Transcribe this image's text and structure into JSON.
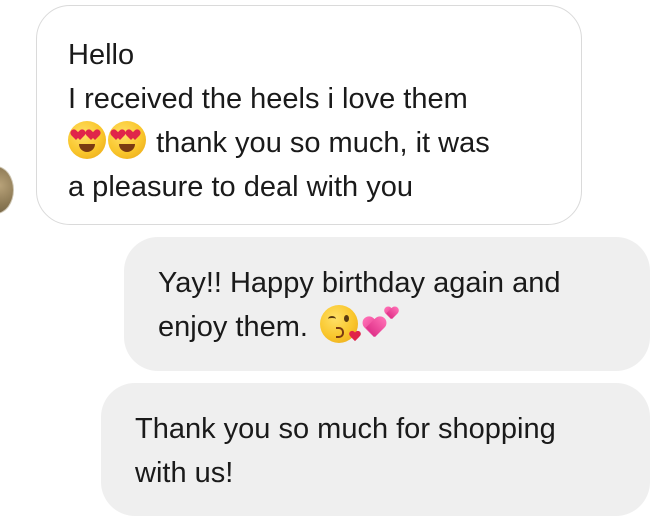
{
  "messages": {
    "incoming": {
      "line1": "Hello",
      "line2": "I received the heels i love them",
      "line3_text": "thank you so much,  it was",
      "line4": "a pleasure to deal with you",
      "emojis": [
        "heart-eyes-face",
        "heart-eyes-face"
      ]
    },
    "reply1": {
      "line1": "Yay!! Happy birthday again and",
      "line2": "enjoy them.",
      "emojis": [
        "kissing-heart-face",
        "two-hearts"
      ]
    },
    "reply2": {
      "line1": "Thank you so much for shopping",
      "line2": "with us!"
    }
  },
  "colors": {
    "incoming_bubble_bg": "#ffffff",
    "incoming_bubble_border": "#dadada",
    "outgoing_bubble_bg": "#efefef",
    "text": "#1a1a1a"
  }
}
